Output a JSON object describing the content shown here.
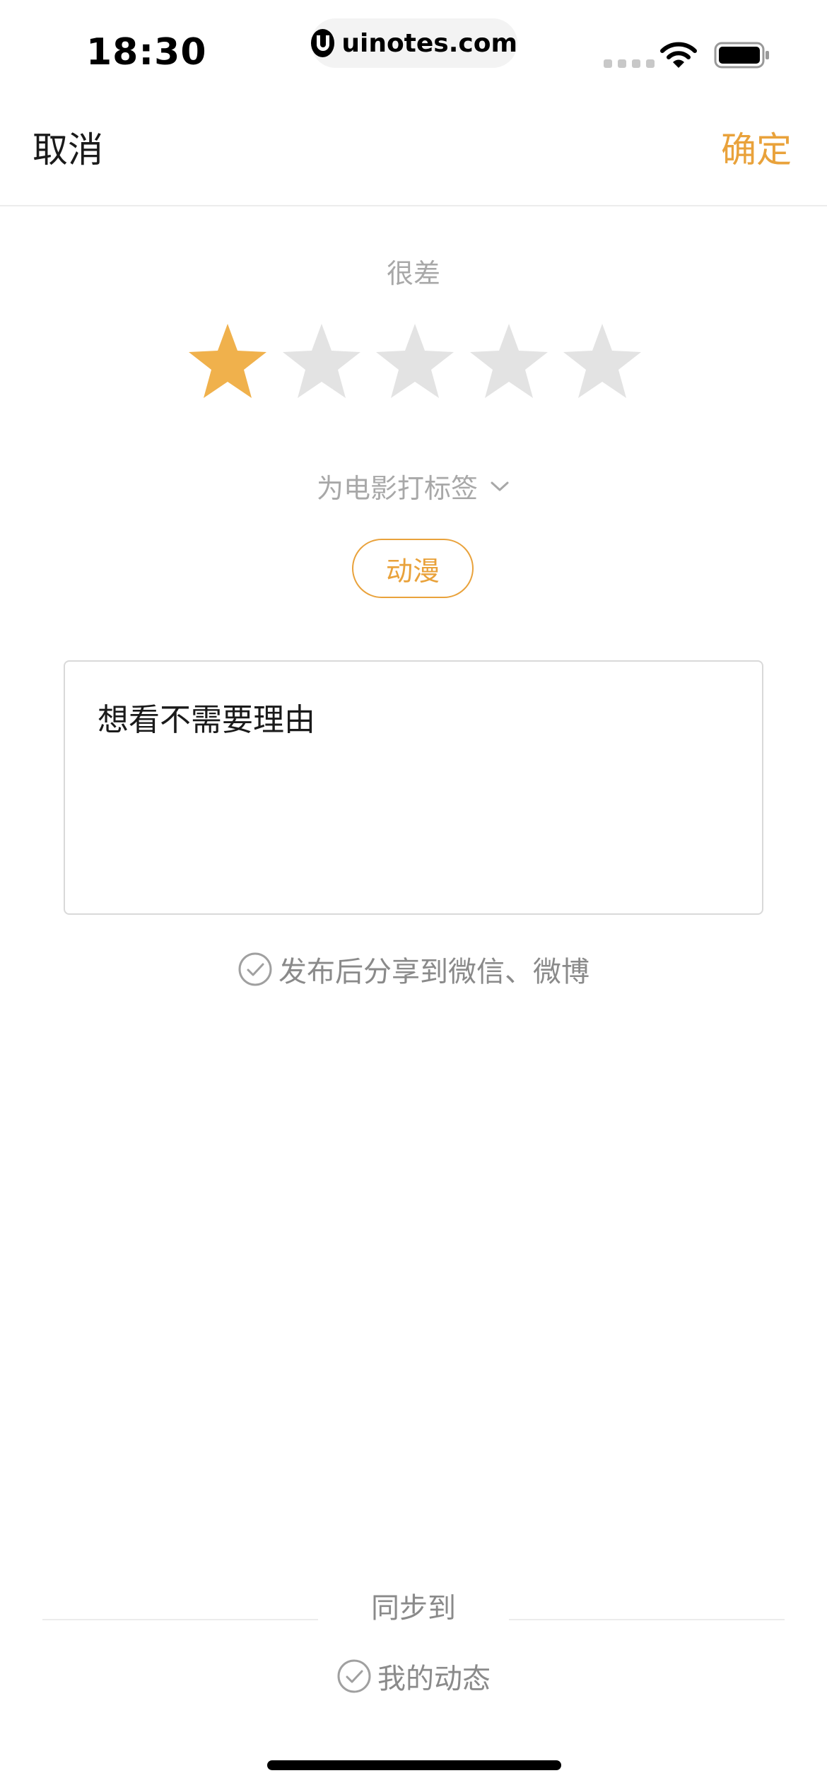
{
  "status_bar": {
    "time": "18:30",
    "url": "uinotes.com",
    "icons": [
      "signal-icon",
      "wifi-icon",
      "battery-icon"
    ]
  },
  "nav": {
    "cancel_label": "取消",
    "confirm_label": "确定"
  },
  "rating": {
    "label": "很差",
    "value": 1,
    "max": 5,
    "active_color": "#F0B14C",
    "inactive_color": "#E3E3E3"
  },
  "tags": {
    "toggle_label": "为电影打标签",
    "toggle_icon": "chevron-down-icon",
    "items": [
      "动漫"
    ],
    "accent_color": "#E9A23B"
  },
  "comment": {
    "placeholder": "想看不需要理由"
  },
  "share": {
    "label": "发布后分享到微信、微博",
    "icon": "check-circle-icon"
  },
  "sync": {
    "title": "同步到",
    "option_label": "我的动态",
    "icon": "check-circle-icon"
  }
}
